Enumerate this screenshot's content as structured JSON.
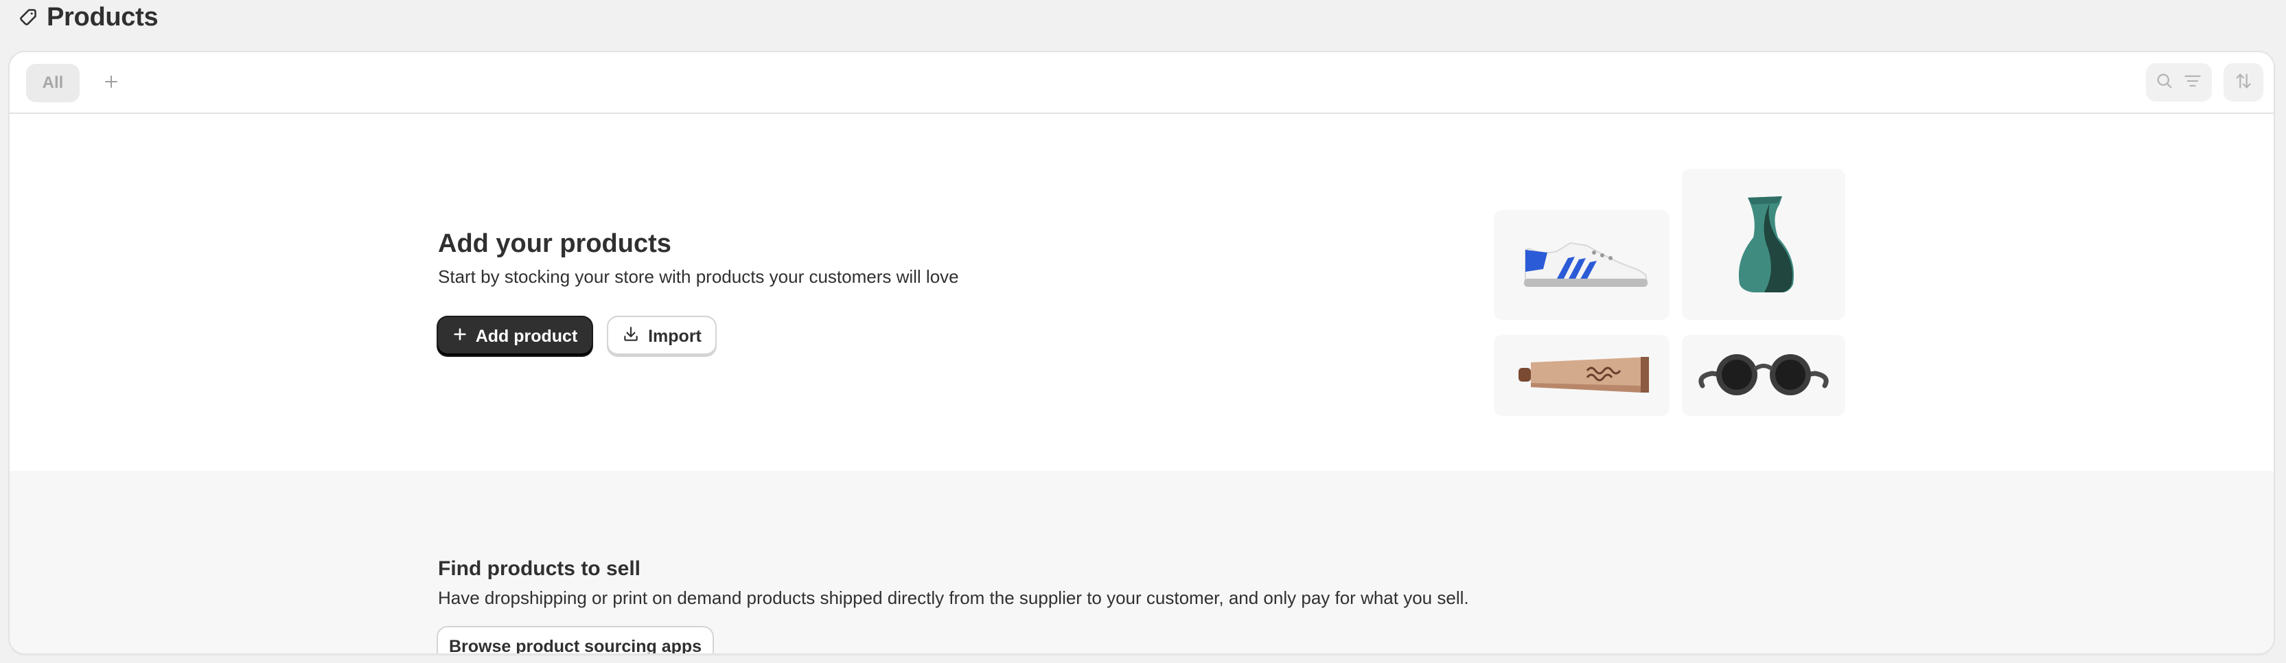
{
  "header": {
    "icon": "tag-icon",
    "title": "Products"
  },
  "tabs": {
    "items": [
      {
        "label": "All",
        "selected": true
      }
    ],
    "add_icon": "plus-icon"
  },
  "toolbar": {
    "search_icon": "search-icon",
    "filter_icon": "filter-icon",
    "sort_icon": "sort-icon"
  },
  "empty_state": {
    "title": "Add your products",
    "description": "Start by stocking your store with products your customers will love",
    "primary_button": "Add product",
    "secondary_button": "Import",
    "illustrations": [
      "sneaker",
      "vase",
      "tube",
      "sunglasses"
    ]
  },
  "find_products": {
    "title": "Find products to sell",
    "description": "Have dropshipping or print on demand products shipped directly from the supplier to your customer, and only pay for what you sell.",
    "button": "Browse product sourcing apps"
  },
  "colors": {
    "background": "#f1f1f1",
    "card": "#ffffff",
    "primary_button": "#303030",
    "text": "#303030"
  }
}
